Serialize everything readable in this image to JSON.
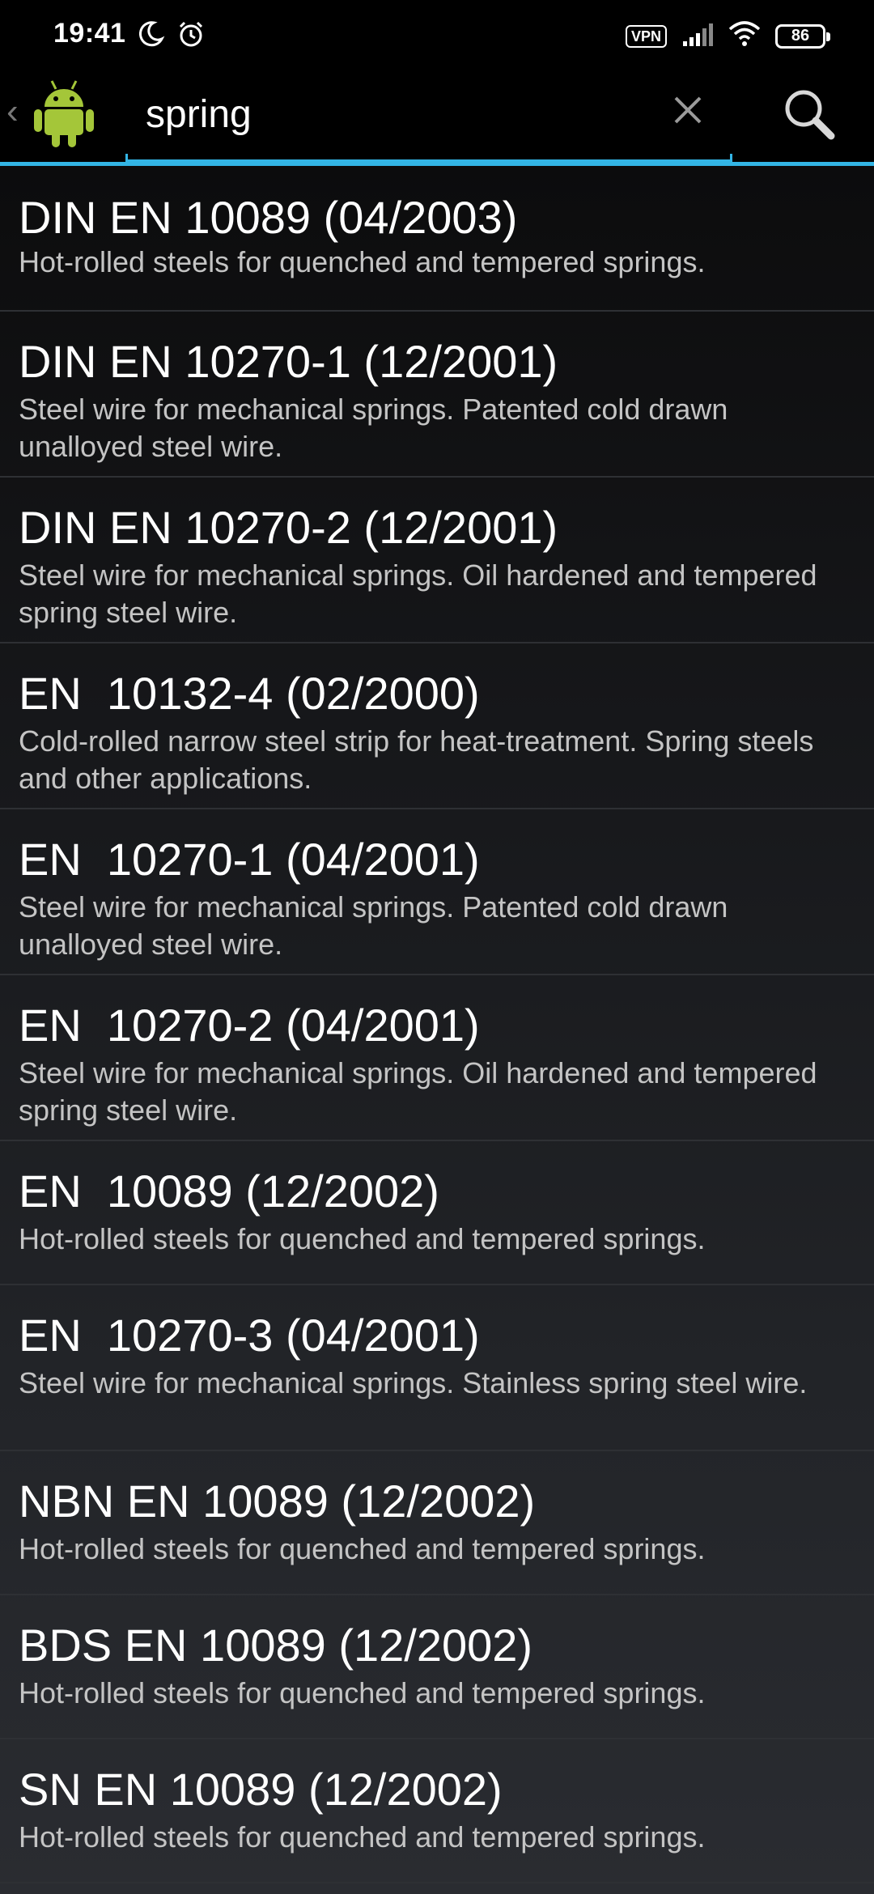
{
  "status_bar": {
    "time": "19:41",
    "vpn_label": "VPN",
    "battery_level": "86",
    "icons": [
      "moon-icon",
      "alarm-icon",
      "vpn-icon",
      "signal-icon",
      "wifi-icon",
      "battery-icon"
    ]
  },
  "action_bar": {
    "app_icon": "android-robot-icon",
    "search_query": "spring",
    "clear_icon": "close-icon",
    "search_icon": "search-icon",
    "accent_color": "#33b5e5"
  },
  "results": [
    {
      "title": "DIN EN 10089 (04/2003)",
      "description": "Hot-rolled steels for quenched and tempered springs."
    },
    {
      "title": "DIN EN 10270-1 (12/2001)",
      "description": "Steel wire for mechanical springs. Patented cold drawn unalloyed steel wire."
    },
    {
      "title": "DIN EN 10270-2 (12/2001)",
      "description": "Steel wire for mechanical springs. Oil hardened and tempered spring steel wire."
    },
    {
      "title": "EN  10132-4 (02/2000)",
      "description": "Cold-rolled narrow steel strip for heat-treatment. Spring steels and other applications."
    },
    {
      "title": "EN  10270-1 (04/2001)",
      "description": "Steel wire for mechanical springs. Patented cold drawn unalloyed steel wire."
    },
    {
      "title": "EN  10270-2 (04/2001)",
      "description": "Steel wire for mechanical springs. Oil hardened and tempered spring steel wire."
    },
    {
      "title": "EN  10089 (12/2002)",
      "description": "Hot-rolled steels for quenched and tempered springs."
    },
    {
      "title": "EN  10270-3 (04/2001)",
      "description": "Steel wire for mechanical springs. Stainless spring steel wire."
    },
    {
      "title": "NBN EN 10089 (12/2002)",
      "description": "Hot-rolled steels for quenched and tempered springs."
    },
    {
      "title": "BDS EN 10089 (12/2002)",
      "description": "Hot-rolled steels for quenched and tempered springs."
    },
    {
      "title": "SN EN 10089 (12/2002)",
      "description": "Hot-rolled steels for quenched and tempered springs."
    }
  ]
}
